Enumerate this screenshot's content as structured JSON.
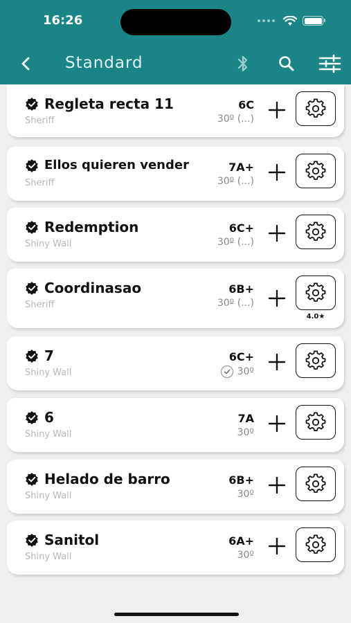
{
  "status": {
    "time": "16:26"
  },
  "header": {
    "title": "Standard",
    "back_icon": "chevron-left-icon",
    "bluetooth_icon": "bluetooth-icon",
    "search_icon": "search-icon",
    "filter_icon": "sliders-icon"
  },
  "colors": {
    "header_bg": "#1b8486",
    "page_bg": "#efefef"
  },
  "routes": [
    {
      "name": "Regleta recta 11",
      "wall": "Sheriff",
      "grade": "6C",
      "angle": "30º (...)"
    },
    {
      "name": "Ellos quieren vender",
      "wall": "Sheriff",
      "grade": "7A+",
      "angle": "30º (...)"
    },
    {
      "name": "Redemption",
      "wall": "Shiny Wall",
      "grade": "6C+",
      "angle": "30º (...)"
    },
    {
      "name": "Coordinasao",
      "wall": "Sheriff",
      "grade": "6B+",
      "angle": "30º (...)",
      "rating": "4.0★"
    },
    {
      "name": "7",
      "wall": "Shiny Wall",
      "grade": "6C+",
      "angle": "30º",
      "sent": true
    },
    {
      "name": "6",
      "wall": "Shiny Wall",
      "grade": "7A",
      "angle": "30º"
    },
    {
      "name": "Helado de barro",
      "wall": "Shiny Wall",
      "grade": "6B+",
      "angle": "30º"
    },
    {
      "name": "Sanitol",
      "wall": "Shiny Wall",
      "grade": "6A+",
      "angle": "30º"
    }
  ]
}
